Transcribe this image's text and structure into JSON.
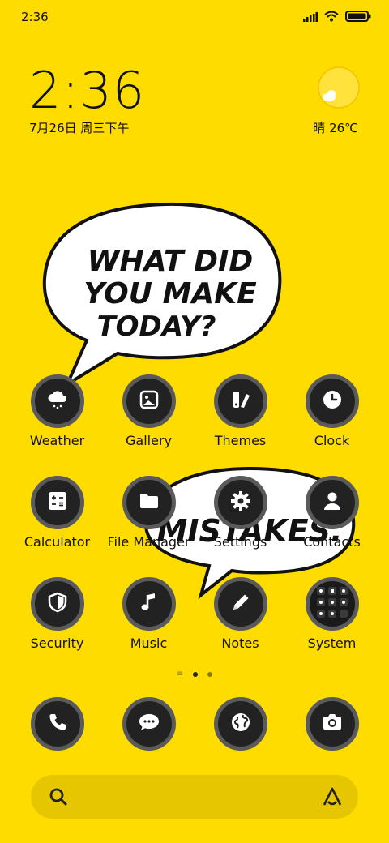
{
  "status_bar": {
    "time": "2:36"
  },
  "clock_widget": {
    "time": "2:36",
    "date": "7月26日 周三下午"
  },
  "weather_widget": {
    "text": "晴 26℃",
    "icon": "sun-cloud-icon"
  },
  "wallpaper": {
    "bubble_top": [
      "WHAT DID",
      "YOU MAKE",
      "TODAY?"
    ],
    "bubble_bottom": "MISTAKES."
  },
  "apps": [
    {
      "label": "Weather",
      "icon": "cloud-snow-icon"
    },
    {
      "label": "Gallery",
      "icon": "image-icon"
    },
    {
      "label": "Themes",
      "icon": "brush-palette-icon"
    },
    {
      "label": "Clock",
      "icon": "clock-icon"
    },
    {
      "label": "Calculator",
      "icon": "calculator-icon"
    },
    {
      "label": "File Manager",
      "icon": "folder-icon"
    },
    {
      "label": "Settings",
      "icon": "gear-icon"
    },
    {
      "label": "Contacts",
      "icon": "person-icon"
    },
    {
      "label": "Security",
      "icon": "shield-icon"
    },
    {
      "label": "Music",
      "icon": "music-note-icon"
    },
    {
      "label": "Notes",
      "icon": "pencil-icon"
    },
    {
      "label": "System",
      "icon": "folder-grid-icon"
    }
  ],
  "dock": [
    {
      "icon": "phone-icon"
    },
    {
      "icon": "message-icon"
    },
    {
      "icon": "browser-globe-icon"
    },
    {
      "icon": "camera-icon"
    }
  ],
  "pager": {
    "count": 2,
    "active": 1
  },
  "search_bar": {
    "placeholder": ""
  },
  "colors": {
    "background": "#FFDC00",
    "icon_bg": "#222222",
    "icon_ring": "#5A5A5A"
  }
}
